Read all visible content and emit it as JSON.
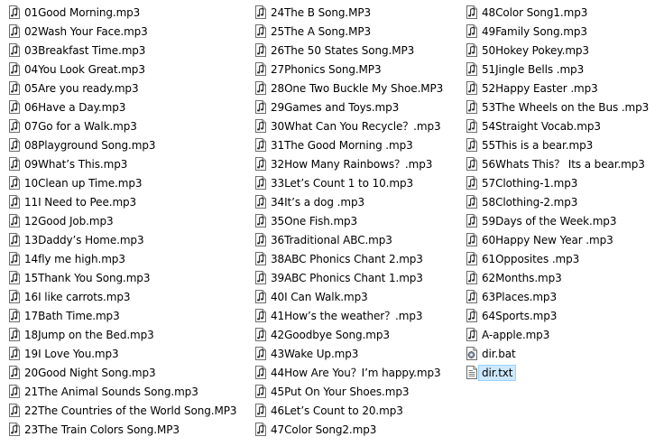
{
  "columns": [
    {
      "items": [
        {
          "name": "01Good Morning.mp3",
          "type": "audio"
        },
        {
          "name": "02Wash Your Face.mp3",
          "type": "audio"
        },
        {
          "name": "03Breakfast Time.mp3",
          "type": "audio"
        },
        {
          "name": "04You Look Great.mp3",
          "type": "audio"
        },
        {
          "name": "05Are you ready.mp3",
          "type": "audio"
        },
        {
          "name": "06Have a Day.mp3",
          "type": "audio"
        },
        {
          "name": "07Go for a Walk.mp3",
          "type": "audio"
        },
        {
          "name": "08Playground Song.mp3",
          "type": "audio"
        },
        {
          "name": "09What’s This.mp3",
          "type": "audio"
        },
        {
          "name": "10Clean up Time.mp3",
          "type": "audio"
        },
        {
          "name": "11I Need to Pee.mp3",
          "type": "audio"
        },
        {
          "name": "12Good Job.mp3",
          "type": "audio"
        },
        {
          "name": "13Daddy’s Home.mp3",
          "type": "audio"
        },
        {
          "name": "14fly me high.mp3",
          "type": "audio"
        },
        {
          "name": "15Thank You Song.mp3",
          "type": "audio"
        },
        {
          "name": "16I like carrots.mp3",
          "type": "audio"
        },
        {
          "name": "17Bath Time.mp3",
          "type": "audio"
        },
        {
          "name": "18Jump on the Bed.mp3",
          "type": "audio"
        },
        {
          "name": "19I Love You.mp3",
          "type": "audio"
        },
        {
          "name": "20Good Night Song.mp3",
          "type": "audio"
        },
        {
          "name": "21The Animal Sounds Song.mp3",
          "type": "audio"
        },
        {
          "name": "22The Countries of the World Song.MP3",
          "type": "audio"
        },
        {
          "name": "23The Train Colors Song.MP3",
          "type": "audio"
        }
      ]
    },
    {
      "items": [
        {
          "name": "24The B Song.MP3",
          "type": "audio"
        },
        {
          "name": "25The A Song.MP3",
          "type": "audio"
        },
        {
          "name": "26The 50 States Song.MP3",
          "type": "audio"
        },
        {
          "name": "27Phonics Song.MP3",
          "type": "audio"
        },
        {
          "name": "28One Two Buckle My Shoe.MP3",
          "type": "audio"
        },
        {
          "name": "29Games and Toys.mp3",
          "type": "audio"
        },
        {
          "name": "30What Can You Recycle？.mp3",
          "type": "audio"
        },
        {
          "name": "31The Good Morning .mp3",
          "type": "audio"
        },
        {
          "name": "32How Many Rainbows？.mp3",
          "type": "audio"
        },
        {
          "name": "33Let’s Count 1 to 10.mp3",
          "type": "audio"
        },
        {
          "name": "34It’s a dog .mp3",
          "type": "audio"
        },
        {
          "name": "35One Fish.mp3",
          "type": "audio"
        },
        {
          "name": "36Traditional ABC.mp3",
          "type": "audio"
        },
        {
          "name": "38ABC Phonics Chant 2.mp3",
          "type": "audio"
        },
        {
          "name": "39ABC Phonics Chant 1.mp3",
          "type": "audio"
        },
        {
          "name": "40I Can Walk.mp3",
          "type": "audio"
        },
        {
          "name": "41How’s the weather？.mp3",
          "type": "audio"
        },
        {
          "name": "42Goodbye Song.mp3",
          "type": "audio"
        },
        {
          "name": "43Wake Up.mp3",
          "type": "audio"
        },
        {
          "name": "44How Are You？I’m happy.mp3",
          "type": "audio"
        },
        {
          "name": "45Put On Your Shoes.mp3",
          "type": "audio"
        },
        {
          "name": "46Let’s Count to 20.mp3",
          "type": "audio"
        },
        {
          "name": "47Color Song2.mp3",
          "type": "audio"
        }
      ]
    },
    {
      "items": [
        {
          "name": "48Color Song1.mp3",
          "type": "audio"
        },
        {
          "name": "49Family Song.mp3",
          "type": "audio"
        },
        {
          "name": "50Hokey Pokey.mp3",
          "type": "audio"
        },
        {
          "name": "51Jingle Bells .mp3",
          "type": "audio"
        },
        {
          "name": "52Happy Easter .mp3",
          "type": "audio"
        },
        {
          "name": "53The Wheels on the Bus .mp3",
          "type": "audio"
        },
        {
          "name": "54Straight Vocab.mp3",
          "type": "audio"
        },
        {
          "name": "55This is a bear.mp3",
          "type": "audio"
        },
        {
          "name": "56Whats This？ Its a bear.mp3",
          "type": "audio"
        },
        {
          "name": "57Clothing-1.mp3",
          "type": "audio"
        },
        {
          "name": "58Clothing-2.mp3",
          "type": "audio"
        },
        {
          "name": "59Days of the Week.mp3",
          "type": "audio"
        },
        {
          "name": "60Happy New Year .mp3",
          "type": "audio"
        },
        {
          "name": "61Opposites .mp3",
          "type": "audio"
        },
        {
          "name": "62Months.mp3",
          "type": "audio"
        },
        {
          "name": "63Places.mp3",
          "type": "audio"
        },
        {
          "name": "64Sports.mp3",
          "type": "audio"
        },
        {
          "name": "A-apple.mp3",
          "type": "audio"
        },
        {
          "name": "dir.bat",
          "type": "batch"
        },
        {
          "name": "dir.txt",
          "type": "text",
          "selected": true
        }
      ]
    }
  ],
  "icons": {
    "audio": "music-file-icon",
    "batch": "batch-file-icon",
    "text": "text-file-icon"
  },
  "colors": {
    "selection_fill": "#cde8ff",
    "selection_border": "#99d1ff",
    "text": "#000000"
  }
}
